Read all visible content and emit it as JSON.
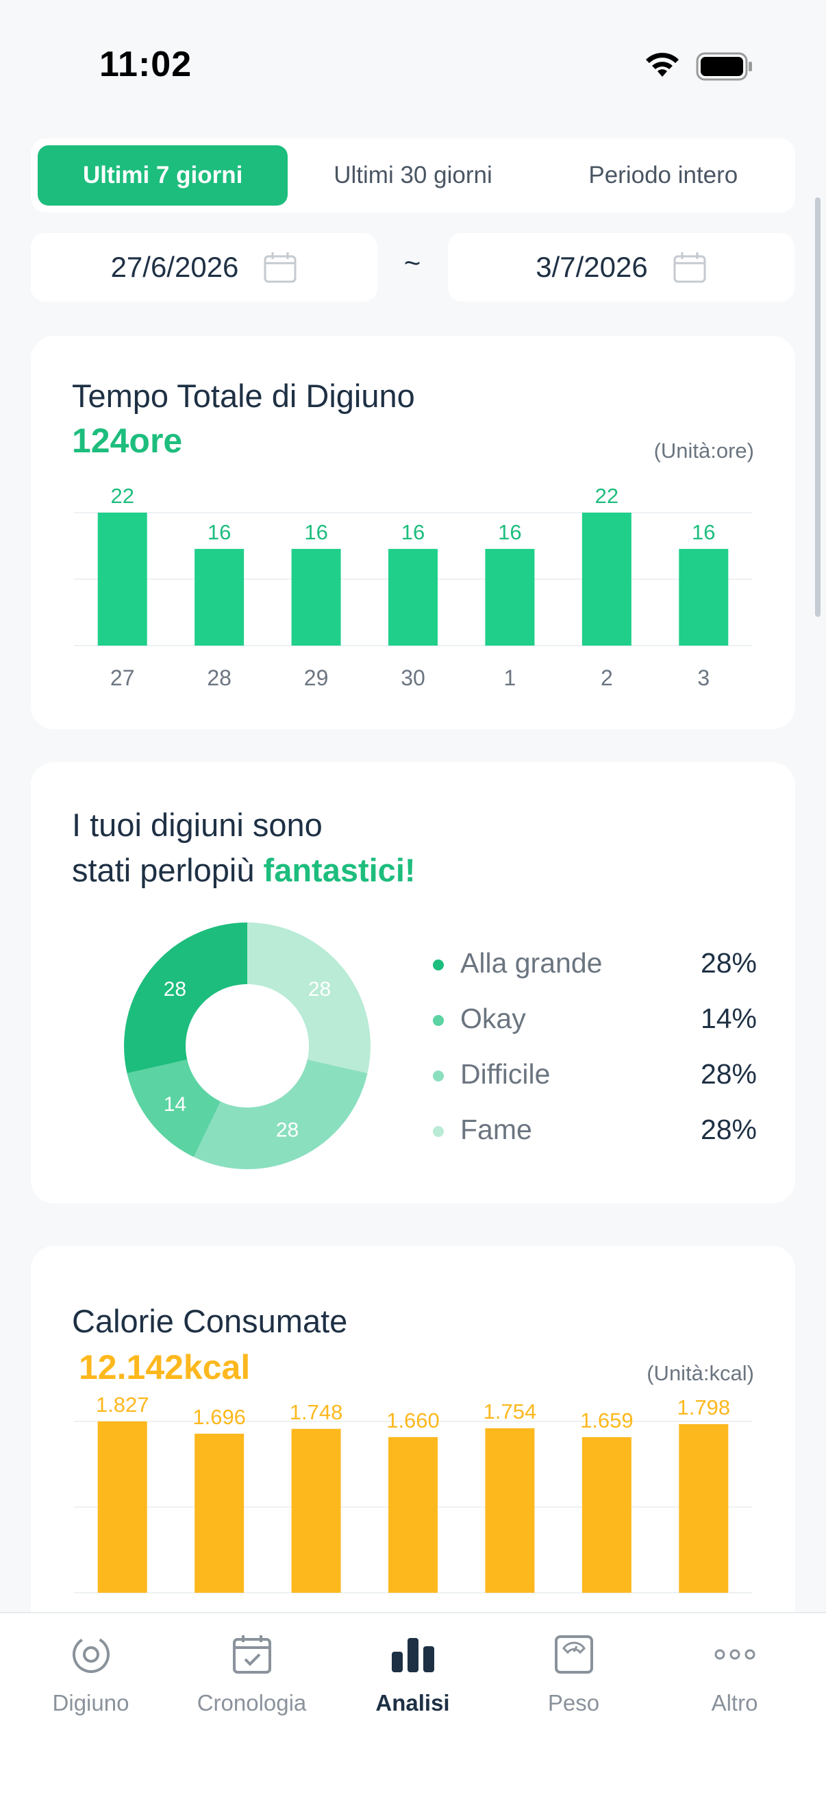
{
  "status_bar": {
    "time": "11:02"
  },
  "segmented": {
    "options": [
      "Ultimi 7 giorni",
      "Ultimi 30 giorni",
      "Periodo intero"
    ],
    "active_index": 0
  },
  "date_range": {
    "start": "27/6/2026",
    "separator": "~",
    "end": "3/7/2026"
  },
  "fasting": {
    "title": "Tempo Totale di Digiuno",
    "total": "124ore",
    "unit": "(Unità:ore)"
  },
  "mood": {
    "line1": "I tuoi digiuni sono",
    "line2_prefix": "stati perlopiù ",
    "line2_highlight": "fantastici!",
    "legend": [
      {
        "label": "Alla grande",
        "value": "28%"
      },
      {
        "label": "Okay",
        "value": "14%"
      },
      {
        "label": "Difficile",
        "value": "28%"
      },
      {
        "label": "Fame",
        "value": "28%"
      }
    ]
  },
  "calories": {
    "title": "Calorie Consumate",
    "total": "12.142kcal",
    "unit": "(Unità:kcal)"
  },
  "tabbar": {
    "items": [
      {
        "label": "Digiuno",
        "icon": "fasting-timer-icon"
      },
      {
        "label": "Cronologia",
        "icon": "calendar-check-icon"
      },
      {
        "label": "Analisi",
        "icon": "bar-chart-icon"
      },
      {
        "label": "Peso",
        "icon": "scale-icon"
      },
      {
        "label": "Altro",
        "icon": "more-dots-icon"
      }
    ],
    "active_index": 2
  },
  "colors": {
    "accent_green": "#1dbd7d",
    "bar_green": "#20cf8a",
    "bar_orange": "#fdb81e",
    "mood_colors": [
      "#1dbd7d",
      "#5bd3a2",
      "#8adfbf",
      "#b9ebd6"
    ]
  },
  "chart_data": [
    {
      "type": "bar",
      "categories": [
        "27",
        "28",
        "29",
        "30",
        "1",
        "2",
        "3"
      ],
      "values": [
        22,
        16,
        16,
        16,
        16,
        22,
        16
      ],
      "data_labels": [
        "22",
        "16",
        "16",
        "16",
        "16",
        "22",
        "16"
      ],
      "title": "Tempo Totale di Digiuno",
      "ylim": [
        0,
        22
      ],
      "grid": true
    },
    {
      "type": "pie",
      "categories": [
        "Alla grande",
        "Okay",
        "Difficile",
        "Fame"
      ],
      "values": [
        28,
        14,
        28,
        28
      ],
      "data_labels": [
        "28",
        "14",
        "28",
        "28"
      ]
    },
    {
      "type": "bar",
      "values": [
        1827,
        1696,
        1748,
        1660,
        1754,
        1659,
        1798
      ],
      "data_labels": [
        "1.827",
        "1.696",
        "1.748",
        "1.660",
        "1.754",
        "1.659",
        "1.798"
      ],
      "title": "Calorie Consumate",
      "ylim": [
        0,
        1827
      ],
      "grid": true
    }
  ]
}
